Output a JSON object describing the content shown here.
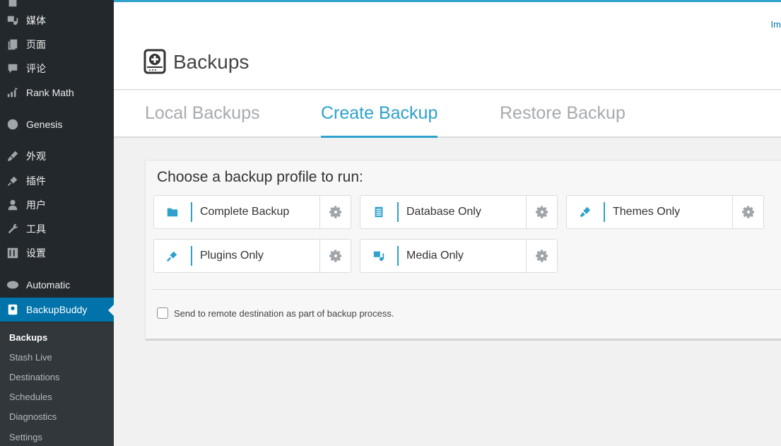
{
  "sidebar": {
    "items": [
      {
        "label": "",
        "icon": "posts-icon"
      },
      {
        "label": "媒体",
        "icon": "media-icon"
      },
      {
        "label": "页面",
        "icon": "pages-icon"
      },
      {
        "label": "评论",
        "icon": "comments-icon"
      },
      {
        "label": "Rank Math",
        "icon": "rank-math-icon"
      },
      {
        "label": "Genesis",
        "icon": "genesis-icon"
      },
      {
        "label": "外观",
        "icon": "appearance-icon"
      },
      {
        "label": "插件",
        "icon": "plugins-icon"
      },
      {
        "label": "用户",
        "icon": "users-icon"
      },
      {
        "label": "工具",
        "icon": "tools-icon"
      },
      {
        "label": "设置",
        "icon": "settings-icon"
      },
      {
        "label": "Automatic",
        "icon": "automatic-icon"
      },
      {
        "label": "BackupBuddy",
        "icon": "backupbuddy-icon"
      }
    ],
    "submenu": [
      "Backups",
      "Stash Live",
      "Destinations",
      "Schedules",
      "Diagnostics",
      "Settings"
    ]
  },
  "header": {
    "title": "Backups",
    "corner_link": "Im"
  },
  "tabs": [
    "Local Backups",
    "Create Backup",
    "Restore Backup"
  ],
  "panel": {
    "title": "Choose a backup profile to run:",
    "profiles": [
      {
        "label": "Complete Backup",
        "icon": "folder-icon"
      },
      {
        "label": "Database Only",
        "icon": "database-icon"
      },
      {
        "label": "Themes Only",
        "icon": "themes-icon"
      },
      {
        "label": "Plugins Only",
        "icon": "plugin-icon"
      },
      {
        "label": "Media Only",
        "icon": "media-icon"
      }
    ],
    "remote_label": "Send to remote destination as part of backup process.",
    "remote_checked": false
  },
  "colors": {
    "sidebar_bg": "#23282d",
    "accent": "#2ea2cc",
    "active_menu": "#0073aa"
  }
}
